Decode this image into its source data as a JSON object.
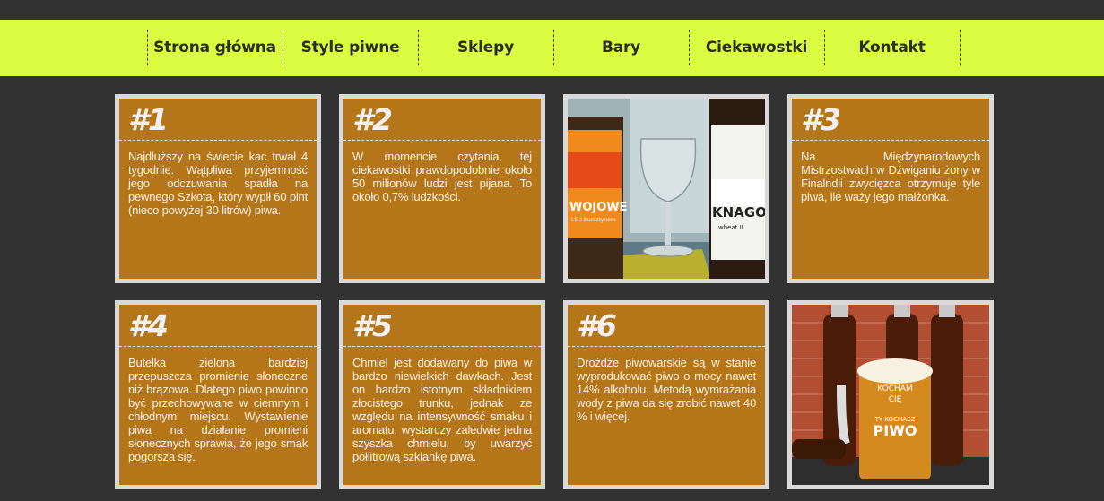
{
  "nav": {
    "items": [
      {
        "label": "Strona główna"
      },
      {
        "label": "Style piwne"
      },
      {
        "label": "Sklepy"
      },
      {
        "label": "Bary"
      },
      {
        "label": "Ciekawostki"
      },
      {
        "label": "Kontakt"
      }
    ]
  },
  "facts": [
    {
      "num": "#1",
      "text": "Najdłuższy na świecie kac trwał 4 tygodnie. Wątpliwa przyjemność jego odczuwania spadła na pewnego Szkota, który wypił 60 pint (nieco powyżej 30 litrów) piwa."
    },
    {
      "num": "#2",
      "text": "W momencie czytania tej ciekawostki prawdopodobnie około 50 milionów ludzi jest pijana. To około 0,7% ludzkości."
    },
    {
      "num": "#3",
      "text": "Na Międzynarodowych Mistrzostwach w Dźwiganiu żony w Finalndii zwycięzca otrzymuje tyle piwa, ile waży jego małżonka."
    },
    {
      "num": "#4",
      "text": "Butelka zielona bardziej przepuszcza promienie słoneczne niż brązowa. Dlatego piwo powinno być przechowywane w ciemnym i chłodnym miejscu. Wystawienie piwa na działanie promieni słonecznych sprawia, że jego smak pogorsza się."
    },
    {
      "num": "#5",
      "text": "Chmiel jest dodawany do piwa w bardzo niewielkich dawkach. Jest on bardzo istotnym składnikiem złocistego trunku, jednak ze względu na intensywność smaku i aromatu, wystarczy zaledwie jedna szyszka chmielu, by uwarzyć półlitrową szklankę piwa."
    },
    {
      "num": "#6",
      "text": "Drożdże piwowarskie są w stanie wyprodukować piwo o mocy nawet 14% alkoholu. Metodą wymrażania wody z piwa da się zrobić nawet 40 % i więcej."
    }
  ],
  "photos": {
    "photo1": {
      "label_left": "WOJOWE",
      "label_left_sub": "LE z bursztynem",
      "label_right": "KNAGO",
      "label_right_sub": "wheat II"
    },
    "photo2": {
      "mug_line1": "KOCHAM",
      "mug_line2": "CIĘ",
      "mug_line3": "TY KOCHASZ",
      "mug_line4": "PIWO"
    }
  }
}
